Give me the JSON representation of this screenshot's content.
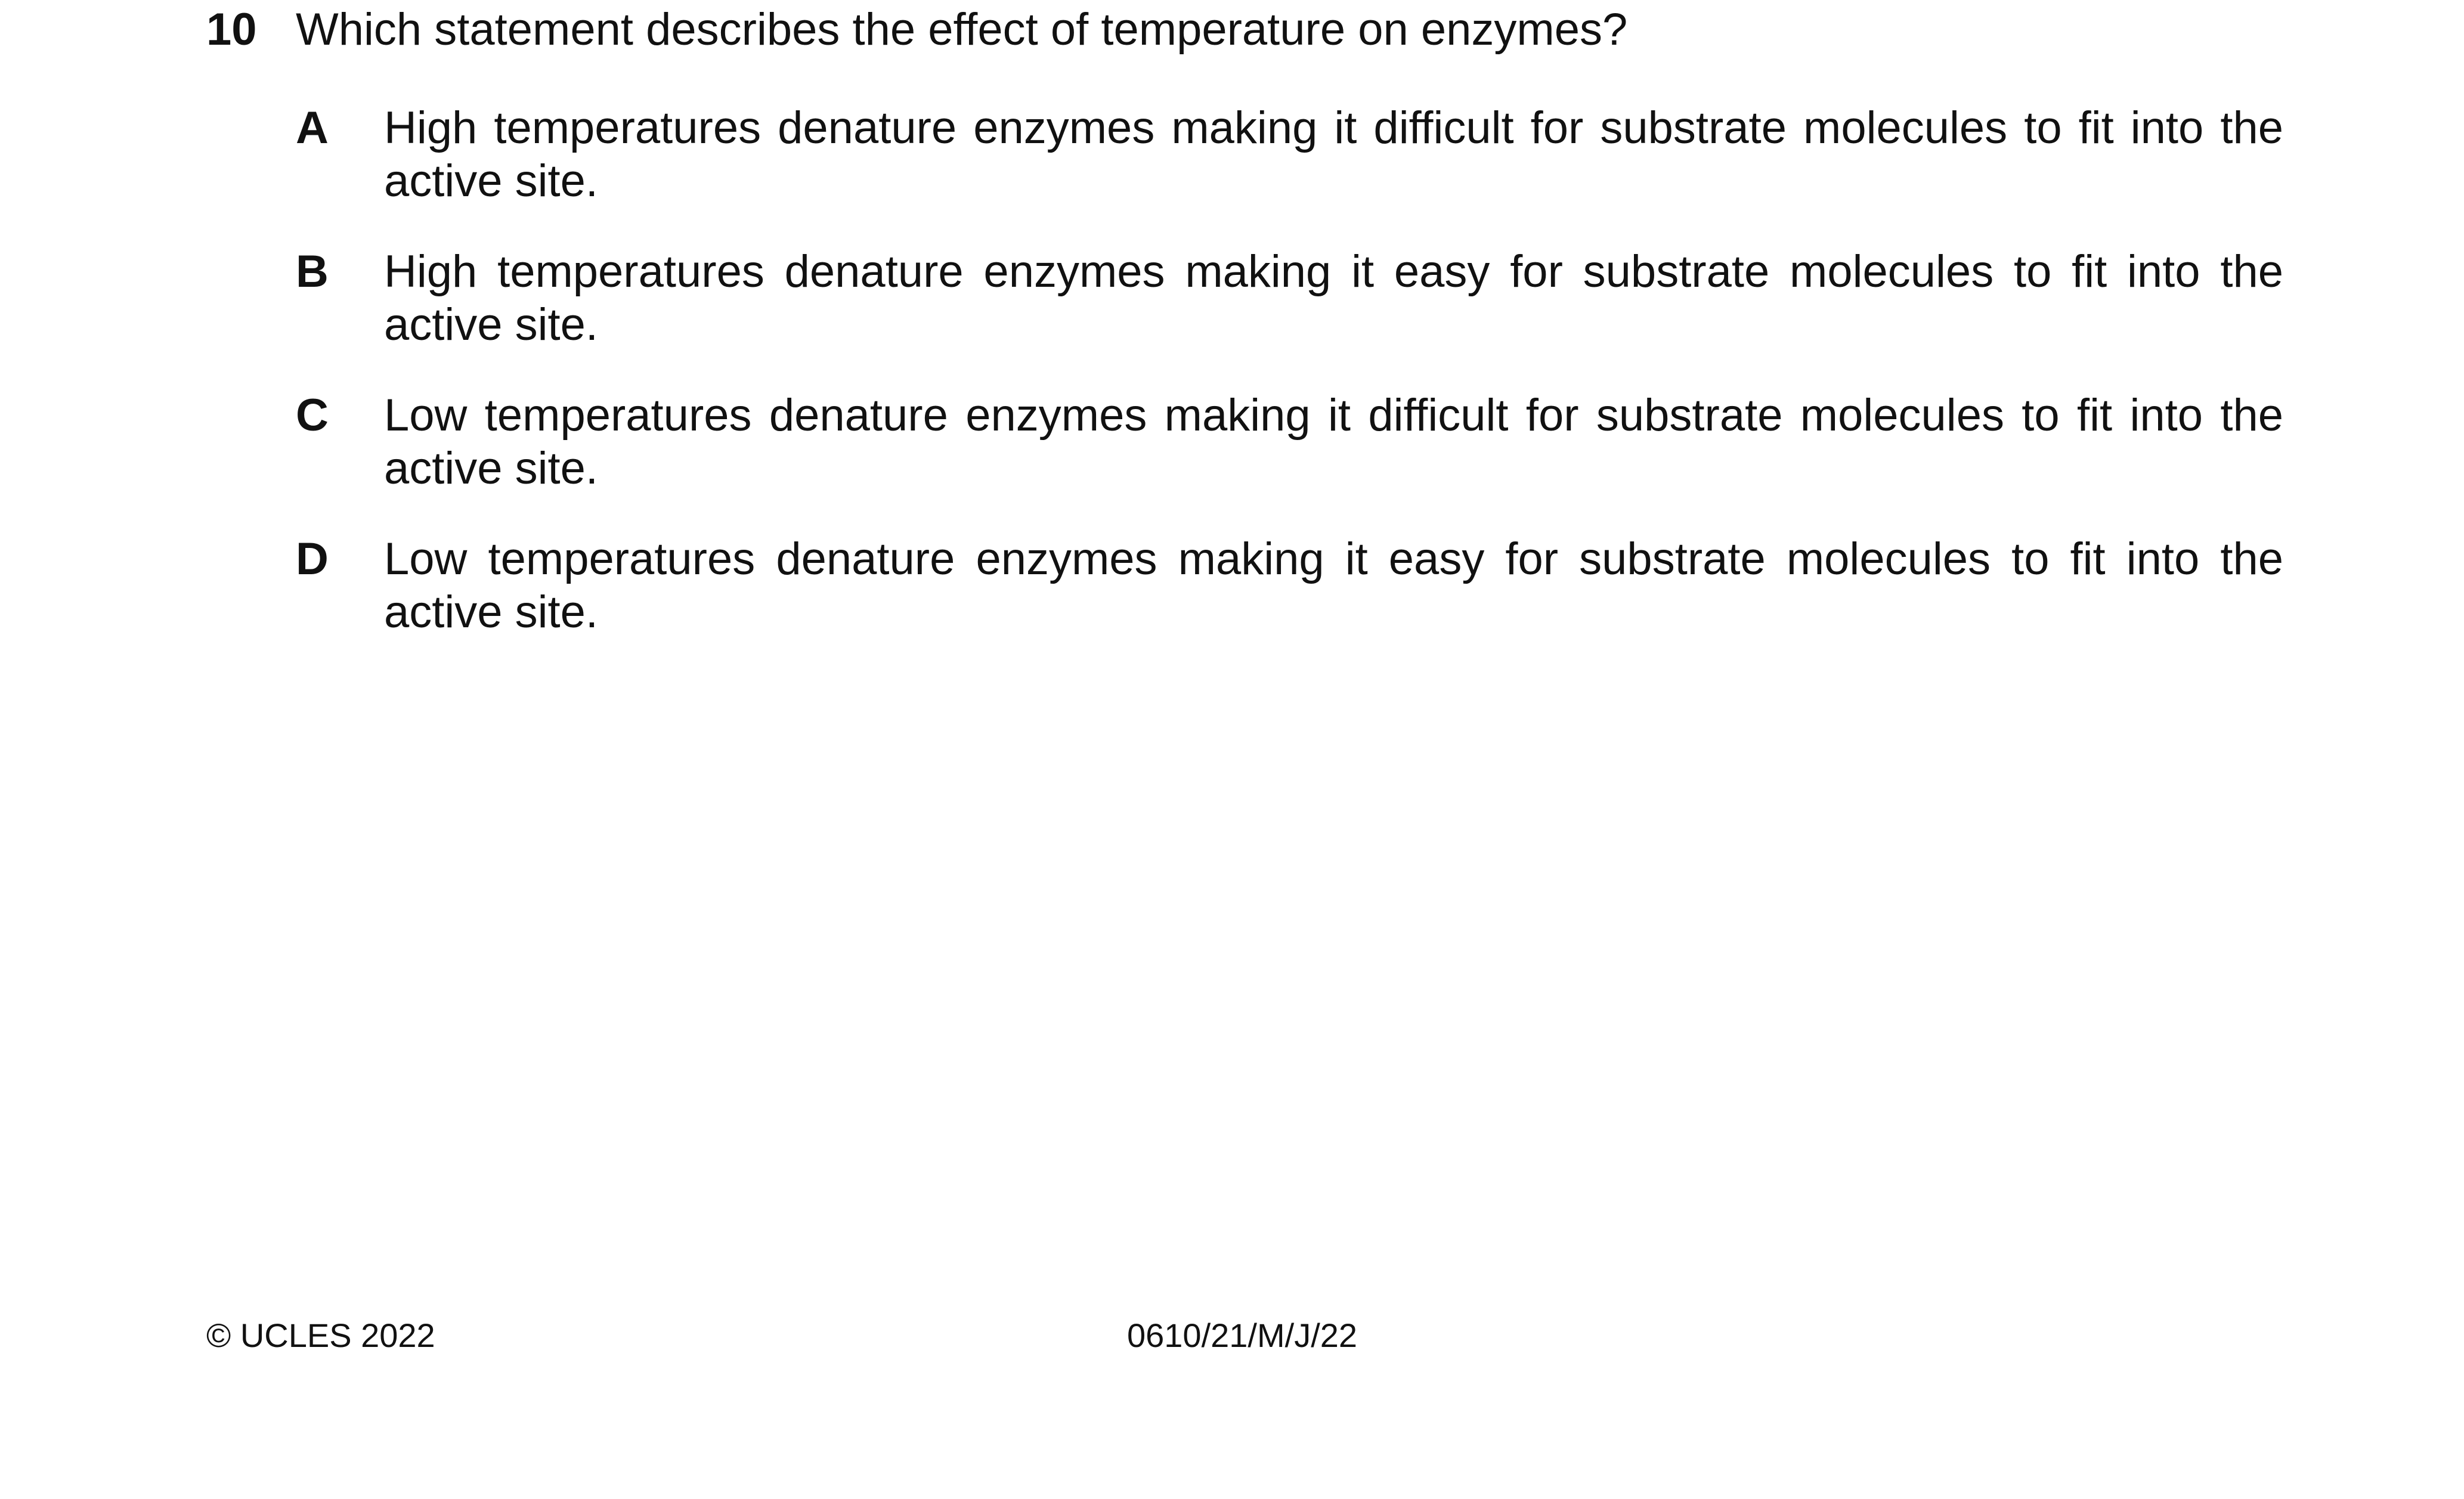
{
  "question": {
    "number": "10",
    "stem": "Which statement describes the effect of temperature on enzymes?",
    "options": [
      {
        "letter": "A",
        "text": "High temperatures denature enzymes making it difficult for substrate molecules to fit into the active site."
      },
      {
        "letter": "B",
        "text": "High temperatures denature enzymes making it easy for substrate molecules to fit into the active site."
      },
      {
        "letter": "C",
        "text": "Low temperatures denature enzymes making it difficult for substrate molecules to fit into the active site."
      },
      {
        "letter": "D",
        "text": "Low temperatures denature enzymes making it easy for substrate molecules to fit into the active site."
      }
    ]
  },
  "footer": {
    "copyright": "© UCLES 2022",
    "paper_code": "0610/21/M/J/22"
  }
}
